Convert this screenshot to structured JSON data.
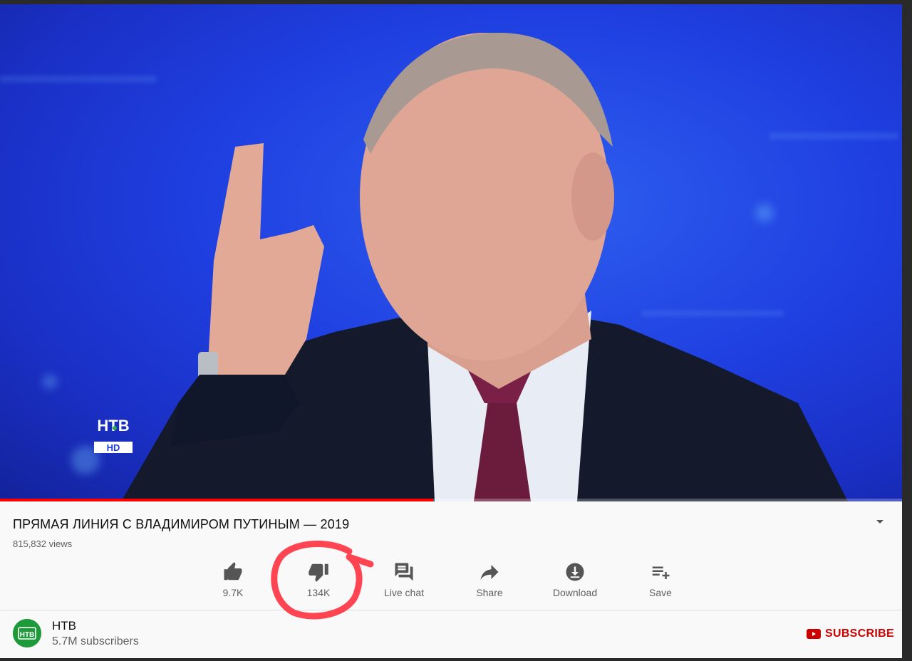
{
  "video": {
    "title": "ПРЯМАЯ ЛИНИЯ С ВЛАДИМИРОМ ПУТИНЫМ — 2019",
    "views": "815,832 views",
    "progress": 0.48,
    "channel_logo_text": "НТВ HD"
  },
  "actions": [
    {
      "label": "9.7K",
      "icon": "thumbs-up-icon"
    },
    {
      "label": "134K",
      "icon": "thumbs-down-icon"
    },
    {
      "label": "Live chat",
      "icon": "live-chat-icon"
    },
    {
      "label": "Share",
      "icon": "share-icon"
    },
    {
      "label": "Download",
      "icon": "download-icon"
    },
    {
      "label": "Save",
      "icon": "save-playlist-icon"
    }
  ],
  "channel": {
    "name": "НТВ",
    "subscribers": "5.7M subscribers",
    "subscribe_label": "SUBSCRIBE"
  },
  "colors": {
    "accent_red": "#cc0000",
    "annotation_marker": "#ff2a3a",
    "video_background": "#1f3fe0"
  }
}
